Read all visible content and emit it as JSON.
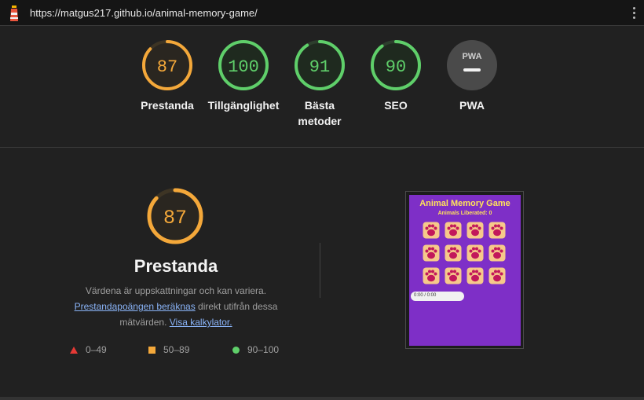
{
  "browser": {
    "url": "https://matgus217.github.io/animal-memory-game/"
  },
  "gauges": [
    {
      "score": "87",
      "label": "Prestanda",
      "color": "#f4a83a",
      "fraction": 0.87
    },
    {
      "score": "100",
      "label": "Tillgänglighet",
      "color": "#5fcf6a",
      "fraction": 1.0
    },
    {
      "score": "91",
      "label": "Bästa metoder",
      "color": "#5fcf6a",
      "fraction": 0.91
    },
    {
      "score": "90",
      "label": "SEO",
      "color": "#5fcf6a",
      "fraction": 0.9
    },
    {
      "score": "",
      "label": "PWA",
      "color": "#5a5a5a",
      "fraction": 0
    }
  ],
  "pwa_badge_text": "PWA",
  "performance": {
    "score": "87",
    "color": "#f4a83a",
    "fraction": 0.87,
    "title": "Prestanda",
    "desc_line1": "Värdena är uppskattningar och kan variera.",
    "link1": "Prestandapoängen beräknas",
    "desc_line2_rest": " direkt utifrån dessa",
    "desc_line3": "mätvärden. ",
    "link2": "Visa kalkylator."
  },
  "legend": [
    {
      "icon": "fail-triangle-icon",
      "range": "0–49",
      "color": "#e53935"
    },
    {
      "icon": "average-square-icon",
      "range": "50–89",
      "color": "#f4a83a"
    },
    {
      "icon": "pass-circle-icon",
      "range": "90–100",
      "color": "#5fcf6a"
    }
  ],
  "screenshot": {
    "title": "Animal Memory Game",
    "subtitle": "Animals Liberated: 0",
    "audio_time": "0:00 / 0:00",
    "background": "#7e2fc7"
  }
}
